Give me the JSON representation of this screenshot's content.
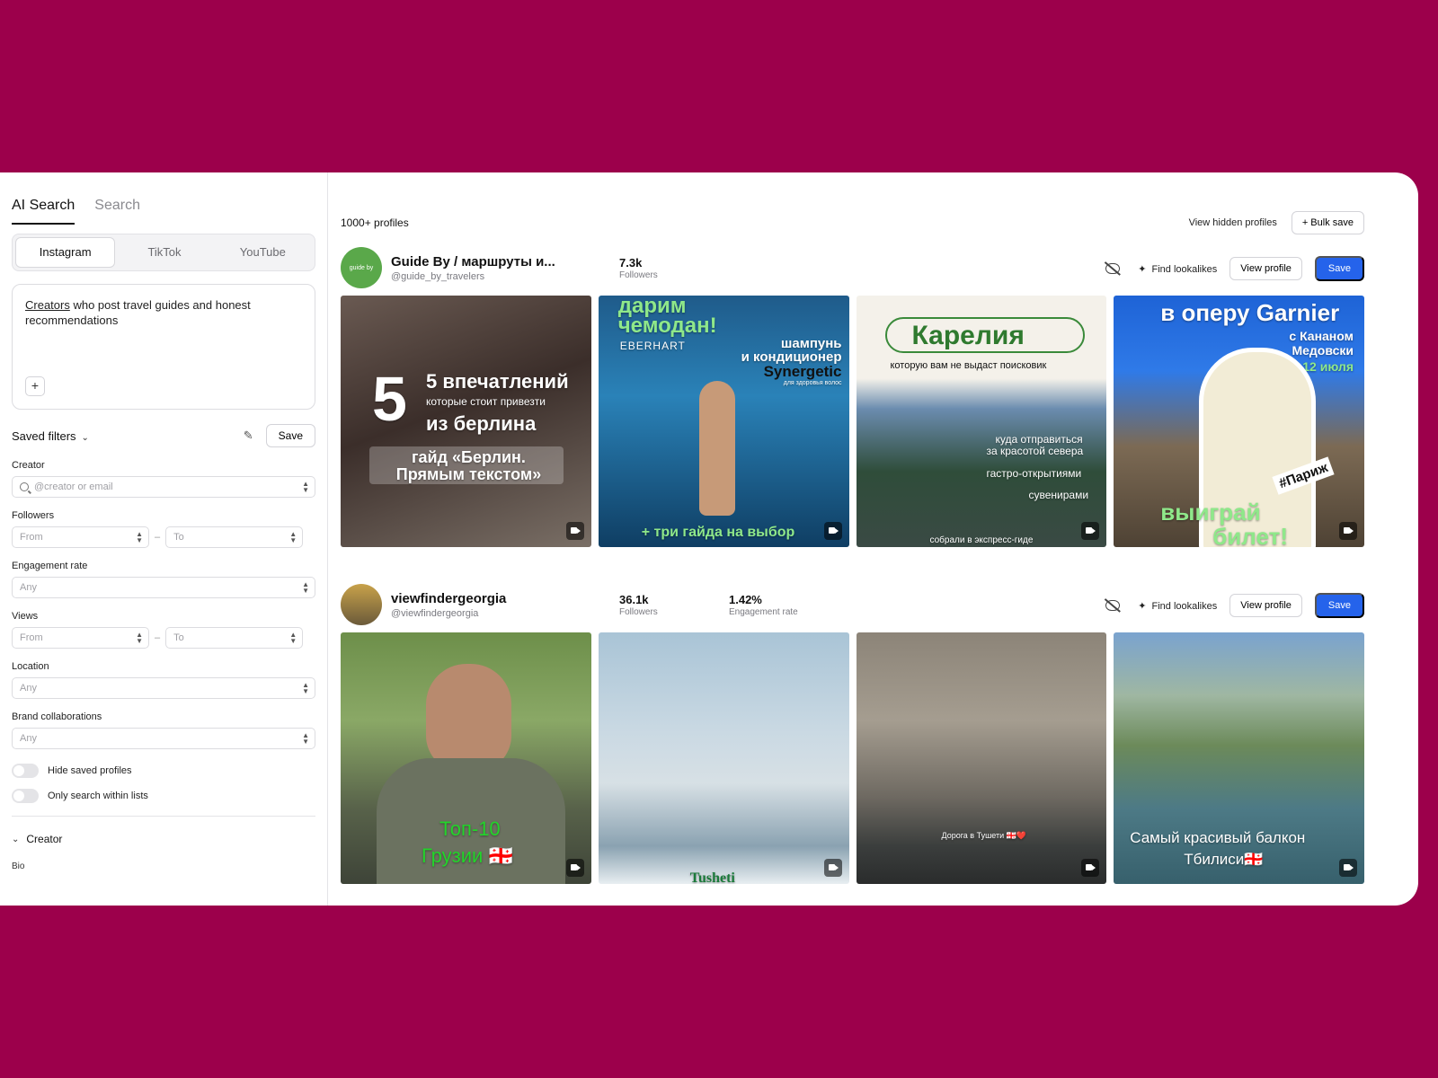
{
  "sidebar": {
    "tabs": [
      "AI Search",
      "Search"
    ],
    "platforms": [
      "Instagram",
      "TikTok",
      "YouTube"
    ],
    "prompt": {
      "word1": "Creators",
      "rest": " who post travel guides and honest recommendations"
    },
    "plus": "+",
    "saved_filters": "Saved filters",
    "save": "Save",
    "creator_label": "Creator",
    "creator_placeholder": "@creator or email",
    "followers_label": "Followers",
    "from": "From",
    "to": "To",
    "dash": "–",
    "engagement_label": "Engagement rate",
    "any": "Any",
    "views_label": "Views",
    "location_label": "Location",
    "brand_label": "Brand collaborations",
    "hide_saved": "Hide saved profiles",
    "only_lists": "Only search within lists",
    "creator_section": "Creator",
    "bio_label": "Bio"
  },
  "main": {
    "results_count": "1000+ profiles",
    "view_hidden": "View hidden profiles",
    "bulk_save": "+ Bulk save",
    "find_lookalikes": "Find lookalikes",
    "view_profile": "View profile",
    "save": "Save",
    "profiles": [
      {
        "name": "Guide By / маршруты и...",
        "handle": "@guide_by_travelers",
        "avatar_text": "guide by",
        "followers": "7.3k",
        "followers_label": "Followers",
        "posts": [
          {
            "lines": [
              "5 впечатлений",
              "которые стоит привезти",
              "из берлина",
              "гайд «Берлин.",
              "Прямым текстом»"
            ]
          },
          {
            "lines": [
              "дарим",
              "чемодан!",
              "EBERHART",
              "шампунь",
              "и кондиционер",
              "Synergetic",
              "для здоровья волос",
              "+ три гайда на выбор"
            ]
          },
          {
            "lines": [
              "Карелия",
              "которую вам не выдаст поисковик",
              "куда отправиться",
              "за красотой севера",
              "гастро-открытиями",
              "сувенирами",
              "собрали в экспресс-гиде"
            ]
          },
          {
            "lines": [
              "в оперу Garnier",
              "с Кананом",
              "Медовски",
              "12 июля",
              "#Париж",
              "выиграй",
              "билет!"
            ]
          }
        ]
      },
      {
        "name": "viewfindergeorgia",
        "handle": "@viewfindergeorgia",
        "followers": "36.1k",
        "followers_label": "Followers",
        "engagement": "1.42%",
        "engagement_label": "Engagement rate",
        "posts": [
          {
            "lines": [
              "Топ-10",
              "Грузии 🇬🇪"
            ]
          },
          {
            "lines": [
              "Tusheti"
            ]
          },
          {
            "lines": [
              "Дорога в Тушети 🇬🇪❤️"
            ]
          },
          {
            "lines": [
              "Самый красивый балкон",
              "Тбилиси🇬🇪"
            ]
          }
        ]
      }
    ]
  },
  "colors": {
    "background": "#9c004b",
    "primary": "#2563eb"
  }
}
